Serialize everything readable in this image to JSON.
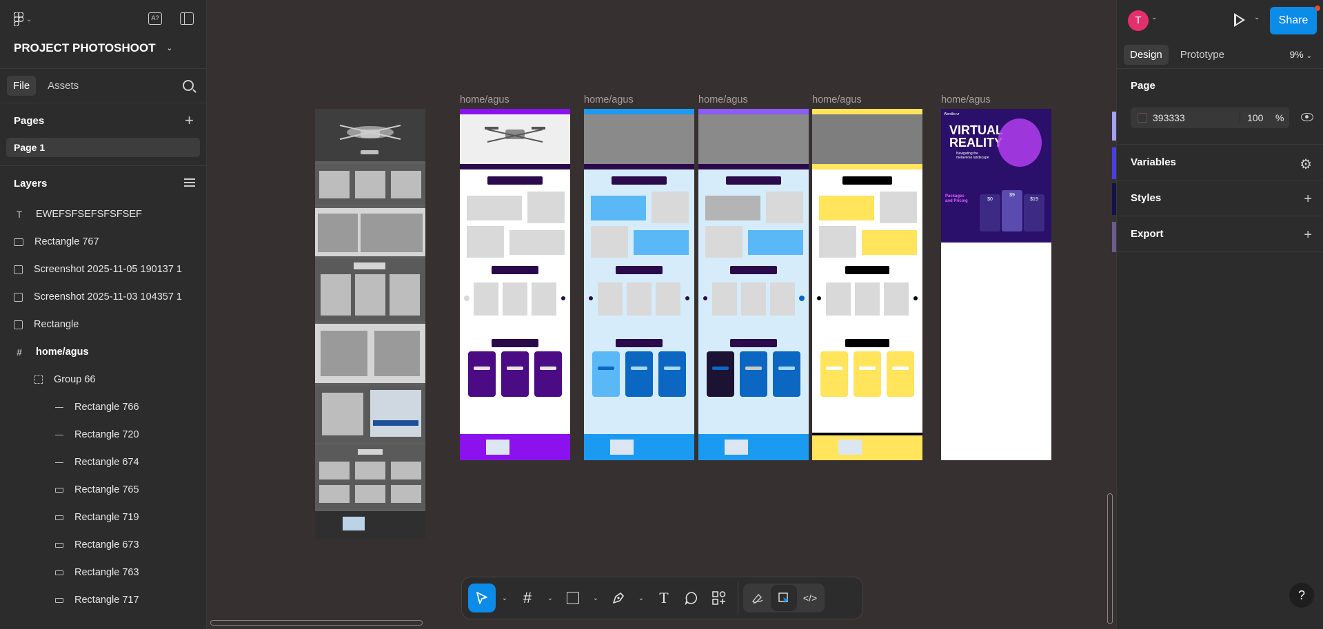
{
  "app": {
    "project_name": "PROJECT PHOTOSHOOT"
  },
  "left_panel": {
    "tabs": [
      {
        "label": "File"
      },
      {
        "label": "Assets"
      }
    ],
    "pages_title": "Pages",
    "pages": [
      {
        "label": "Page 1"
      }
    ],
    "layers_title": "Layers",
    "layers": [
      {
        "label": "EWEFSFSEFSFSFSEF",
        "icon": "text-icon"
      },
      {
        "label": "Rectangle 767",
        "icon": "rectangle-icon"
      },
      {
        "label": "Screenshot 2025-11-05 190137 1",
        "icon": "image-icon"
      },
      {
        "label": "Screenshot 2025-11-03 104357 1",
        "icon": "image-icon"
      },
      {
        "label": "Rectangle",
        "icon": "image-icon"
      },
      {
        "label": "home/agus",
        "icon": "frame-icon"
      },
      {
        "label": "Group 66",
        "icon": "group-icon"
      },
      {
        "label": "Rectangle 766",
        "icon": "line-icon"
      },
      {
        "label": "Rectangle 720",
        "icon": "line-icon"
      },
      {
        "label": "Rectangle 674",
        "icon": "line-icon"
      },
      {
        "label": "Rectangle 765",
        "icon": "rectangle-icon"
      },
      {
        "label": "Rectangle 719",
        "icon": "rectangle-icon"
      },
      {
        "label": "Rectangle 673",
        "icon": "rectangle-icon"
      },
      {
        "label": "Rectangle 763",
        "icon": "rectangle-icon"
      },
      {
        "label": "Rectangle 717",
        "icon": "rectangle-icon"
      }
    ]
  },
  "canvas": {
    "frame_labels": [
      "home/agus",
      "home/agus",
      "home/agus",
      "home/agus",
      "home/agus"
    ],
    "vr_frame": {
      "logo": "Wordlie.vr",
      "headline_1": "VIRTUAL",
      "headline_2": "REALITY",
      "sub": "Navigating the",
      "sub2": "metaverse landscape",
      "pricing_title_1": "Packages",
      "pricing_title_2": "and Pricing",
      "prices": [
        "$0",
        "$9",
        "$19"
      ]
    },
    "colors": {
      "purple": "#8b12ee",
      "blue": "#1b9af1",
      "violet": "#8b5cf6",
      "yellow": "#ffe45c",
      "dark_purple": "#2b0a4b"
    }
  },
  "toolbar": {
    "tools": [
      "move-tool",
      "frame-tool",
      "shape-tool",
      "pen-tool",
      "text-tool",
      "comment-tool",
      "actions-tool",
      "draw-mode",
      "design-mode",
      "dev-mode"
    ]
  },
  "right_panel": {
    "avatar_initial": "T",
    "share_label": "Share",
    "tabs": [
      {
        "label": "Design"
      },
      {
        "label": "Prototype"
      }
    ],
    "zoom": "9%",
    "page_title": "Page",
    "page_color": "393333",
    "page_opacity": "100",
    "percent_sign": "%",
    "sections": [
      {
        "label": "Variables"
      },
      {
        "label": "Styles"
      },
      {
        "label": "Export"
      }
    ]
  },
  "help_label": "?"
}
